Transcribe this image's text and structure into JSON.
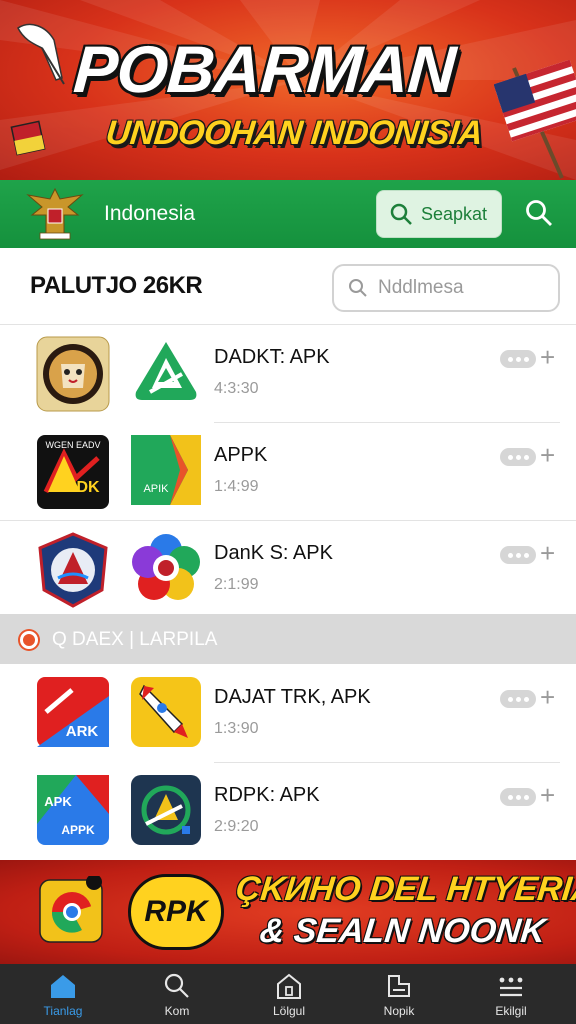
{
  "banner": {
    "title": "POBARMAN",
    "subtitle": "UNDOOHAN INDONISIA"
  },
  "header": {
    "title": "Indonesia",
    "search_button_label": "Seapkat",
    "icons": [
      "garuda-emblem",
      "search-icon"
    ]
  },
  "list": {
    "title": "PALUTJO 26KR",
    "search_placeholder": "Nddlmesa"
  },
  "apps_top": [
    {
      "name": "DADKT: APK",
      "meta": "4:3:30"
    },
    {
      "name": "APPK",
      "meta": "1:4:99"
    },
    {
      "name": "DanK S: APK",
      "meta": "2:1:99"
    }
  ],
  "section": {
    "label": "Q DAEX | LARPILA"
  },
  "apps_bottom": [
    {
      "name": "DAJAT TRK, APK",
      "meta": "1:3:90"
    },
    {
      "name": "RDPK: APK",
      "meta": "2:9:20"
    }
  ],
  "icon_labels": {
    "adk_top": "WGEN EADV",
    "adk_bottom": "DK",
    "apk_green": "APIK",
    "ark": "ARK",
    "apk_small": "APK",
    "apk_blue": "APPK",
    "promo_badge": "RPK"
  },
  "promo": {
    "line1": "ÇKИHO DEL HTYERIAR,",
    "line2": "& SEALN NOONK"
  },
  "nav": [
    {
      "label": "Tianlag"
    },
    {
      "label": "Kom"
    },
    {
      "label": "Lölgul"
    },
    {
      "label": "Nopik"
    },
    {
      "label": "Ekilgil"
    }
  ],
  "colors": {
    "header_green": "#1fa34a",
    "banner_red": "#d8321a",
    "title_yellow": "#ffd21f",
    "nav_active": "#3a9be8",
    "nav_bg": "#2a2a2a"
  }
}
